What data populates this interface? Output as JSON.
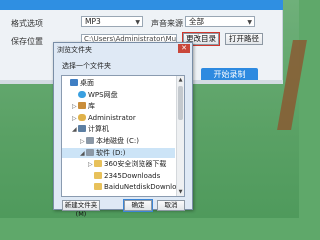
{
  "app": {
    "format_label": "格式选项",
    "format_value": "MP3",
    "source_label": "声音来源",
    "source_value": "全部",
    "save_label": "保存位置",
    "save_path": "C:\\Users\\Administrator\\Music",
    "change_dir_label": "更改目录",
    "open_path_label": "打开路径",
    "start_label": "开始录制"
  },
  "dialog": {
    "title": "浏览文件夹",
    "prompt": "选择一个文件夹",
    "close_glyph": "✕",
    "tree": [
      {
        "label": "桌面",
        "icon": "desktop-icon",
        "level": 0,
        "expander": ""
      },
      {
        "label": "WPS网盘",
        "icon": "cloud-icon",
        "level": 1,
        "expander": ""
      },
      {
        "label": "库",
        "icon": "library-icon",
        "level": 1,
        "expander": "▷"
      },
      {
        "label": "Administrator",
        "icon": "user-icon",
        "level": 1,
        "expander": "▷"
      },
      {
        "label": "计算机",
        "icon": "computer-icon",
        "level": 1,
        "expander": "◢"
      },
      {
        "label": "本地磁盘 (C:)",
        "icon": "drive-icon",
        "level": 2,
        "expander": "▷"
      },
      {
        "label": "软件 (D:)",
        "icon": "drive-icon",
        "level": 2,
        "expander": "◢",
        "selected": true
      },
      {
        "label": "360安全浏览器下载",
        "icon": "folder-icon",
        "level": 3,
        "expander": "▷"
      },
      {
        "label": "2345Downloads",
        "icon": "folder-icon",
        "level": 3,
        "expander": ""
      },
      {
        "label": "BaiduNetdiskDownload",
        "icon": "folder-icon",
        "level": 3,
        "expander": ""
      }
    ],
    "new_folder_label": "新建文件夹(M)",
    "ok_label": "确定",
    "cancel_label": "取消"
  }
}
